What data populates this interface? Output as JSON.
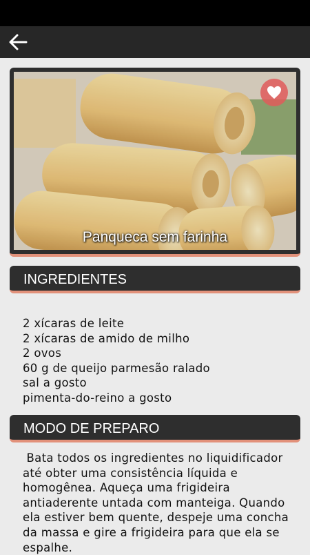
{
  "header": {
    "back_icon": "arrow-left-icon"
  },
  "recipe": {
    "title": "Panqueca sem farinha",
    "favorite_icon": "heart-icon"
  },
  "ingredients": {
    "title": "INGREDIENTES",
    "items": [
      "2 xícaras de leite",
      "2 xícaras de amido de milho",
      "2 ovos",
      "60 g de queijo parmesão ralado",
      "sal a gosto",
      "pimenta-do-reino a gosto"
    ]
  },
  "method": {
    "title": "MODO DE PREPARO",
    "text": " Bata todos os ingredientes no liquidificador até obter uma consistência líquida e homogênea. Aqueça uma frigideira antiaderente untada com manteiga. Quando ela estiver bem quente, despeje uma concha da massa e gire a frigideira para que ela se espalhe."
  },
  "colors": {
    "appbar": "#272727",
    "card": "#2e2e2e",
    "accent": "#e2917a",
    "background": "#ebebeb"
  }
}
